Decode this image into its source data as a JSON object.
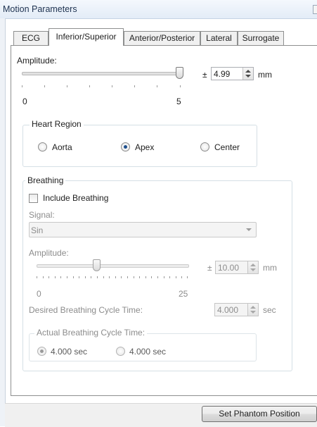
{
  "panel": {
    "title": "Motion Parameters"
  },
  "tabs": [
    {
      "label": "ECG"
    },
    {
      "label": "Inferior/Superior"
    },
    {
      "label": "Anterior/Posterior"
    },
    {
      "label": "Lateral"
    },
    {
      "label": "Surrogate"
    }
  ],
  "active_tab": "Inferior/Superior",
  "amplitude": {
    "label": "Amplitude:",
    "min_label": "0",
    "max_label": "5",
    "value": "4.99",
    "plus_minus": "±",
    "unit": "mm"
  },
  "heart_region": {
    "legend": "Heart Region",
    "options": [
      {
        "label": "Aorta",
        "checked": false
      },
      {
        "label": "Apex",
        "checked": true
      },
      {
        "label": "Center",
        "checked": false
      }
    ]
  },
  "breathing": {
    "legend": "Breathing",
    "include_label": "Include Breathing",
    "include_checked": false,
    "signal_label": "Signal:",
    "signal_value": "Sin",
    "amplitude_label": "Amplitude:",
    "amplitude_min_label": "0",
    "amplitude_max_label": "25",
    "amplitude_value": "10.00",
    "amplitude_plus_minus": "±",
    "amplitude_unit": "mm",
    "cycle_label": "Desired Breathing Cycle Time:",
    "cycle_value": "4.000",
    "cycle_unit": "sec",
    "actual": {
      "legend": "Actual Breathing Cycle Time:",
      "options": [
        {
          "label": "4.000 sec",
          "checked": true
        },
        {
          "label": "4.000 sec",
          "checked": false
        }
      ]
    }
  },
  "footer": {
    "set_phantom_label": "Set Phantom Position"
  }
}
